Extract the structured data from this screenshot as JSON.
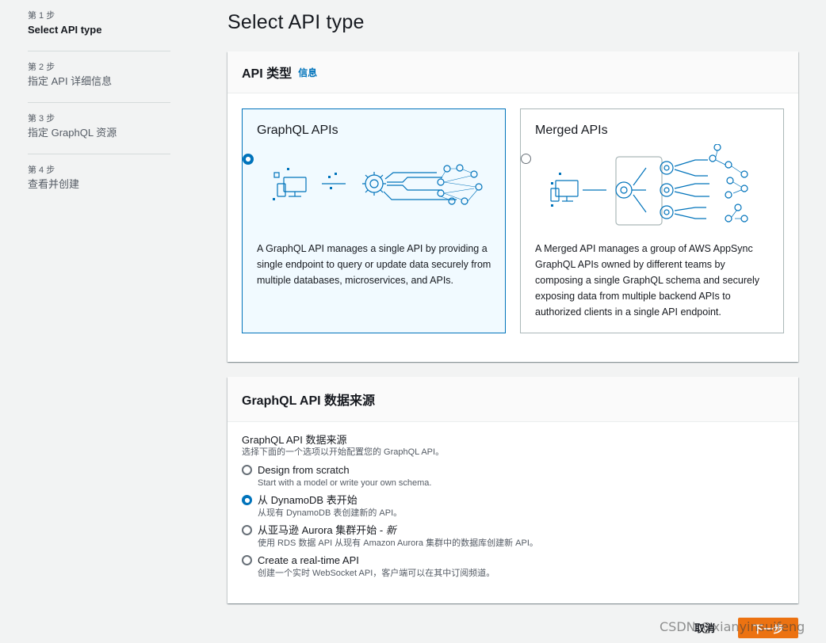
{
  "steps": [
    {
      "num": "第 1 步",
      "title": "Select API type"
    },
    {
      "num": "第 2 步",
      "title": "指定 API 详细信息"
    },
    {
      "num": "第 3 步",
      "title": "指定 GraphQL 资源"
    },
    {
      "num": "第 4 步",
      "title": "查看并创建"
    }
  ],
  "page_title": "Select API type",
  "api_type": {
    "header": "API 类型",
    "info_link": "信息",
    "tiles": [
      {
        "title": "GraphQL APIs",
        "selected": true,
        "description": "A GraphQL API manages a single API by providing a single endpoint to query or update data securely from multiple databases, microservices, and APIs."
      },
      {
        "title": "Merged APIs",
        "selected": false,
        "description": "A Merged API manages a group of AWS AppSync GraphQL APIs owned by different teams by composing a single GraphQL schema and securely exposing data from multiple backend APIs to authorized clients in a single API endpoint."
      }
    ]
  },
  "data_source": {
    "header": "GraphQL API 数据来源",
    "label": "GraphQL API 数据来源",
    "description": "选择下面的一个选项以开始配置您的 GraphQL API。",
    "options": [
      {
        "label": "Design from scratch",
        "suffix": "",
        "desc": "Start with a model or write your own schema.",
        "checked": false
      },
      {
        "label": "从 DynamoDB 表开始",
        "suffix": "",
        "desc": "从现有 DynamoDB 表创建新的 API。",
        "checked": true
      },
      {
        "label": "从亚马逊 Aurora 集群开始 - ",
        "suffix": "新",
        "desc": "使用 RDS 数据 API 从现有 Amazon Aurora 集群中的数据库创建新 API。",
        "checked": false
      },
      {
        "label": "Create a real-time API",
        "suffix": "",
        "desc": "创建一个实时 WebSocket API，客户端可以在其中订阅频道。",
        "checked": false
      }
    ]
  },
  "footer": {
    "cancel": "取消",
    "next": "下一步"
  },
  "watermark": "CSDN @xianyinsuifeng",
  "colors": {
    "accent": "#0073bb",
    "primary_button": "#ec7211",
    "illustration": "#0073bb"
  }
}
